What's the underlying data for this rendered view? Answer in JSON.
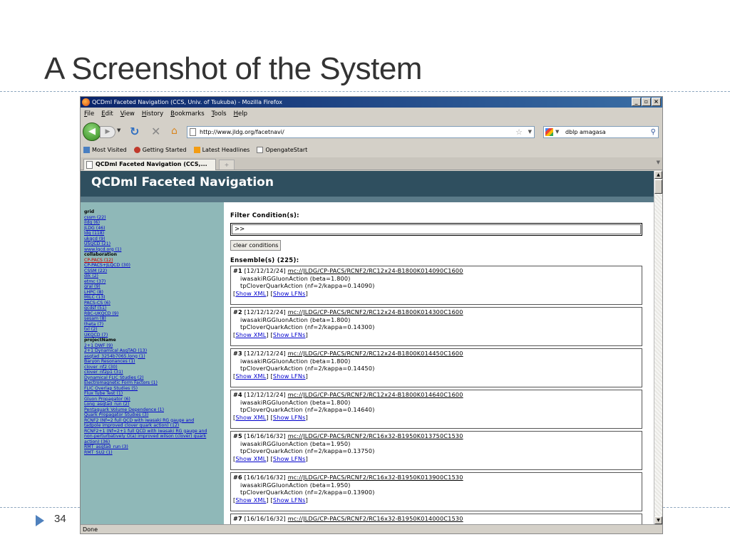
{
  "slide": {
    "title": "A Screenshot of the System",
    "page_number": "34"
  },
  "browser": {
    "window_title": "QCDml Faceted Navigation (CCS, Univ. of Tsukuba) - Mozilla Firefox",
    "menu": [
      "File",
      "Edit",
      "View",
      "History",
      "Bookmarks",
      "Tools",
      "Help"
    ],
    "url": "http://www.jldg.org/facetnavi/",
    "search_value": "dblp amagasa",
    "bookmarks": [
      "Most Visited",
      "Getting Started",
      "Latest Headlines",
      "OpengateStart"
    ],
    "tab_title": "QCDml Faceted Navigation (CCS,...",
    "status": "Done",
    "colors": {
      "header_bg": "#2f4f5f",
      "sidebar_bg": "#8fb8b8",
      "link": "#0000cc",
      "active_link": "#cc0000"
    },
    "icons": [
      "firefox-icon",
      "back-icon",
      "forward-icon",
      "reload-icon",
      "stop-icon",
      "home-icon",
      "page-icon",
      "star-icon",
      "google-icon",
      "magnifier-icon"
    ]
  },
  "page": {
    "header": "QCDml Faceted Navigation",
    "facets": [
      {
        "title": "grid",
        "items": [
          {
            "label": "cssm (22)",
            "active": false
          },
          {
            "label": "ildg (6)",
            "active": false
          },
          {
            "label": "JLDG (46)",
            "active": false
          },
          {
            "label": "ldg (118)",
            "active": false
          },
          {
            "label": "ukqcd (9)",
            "active": false
          },
          {
            "label": "USQCD (21)",
            "active": false
          },
          {
            "label": "www.lqcd.org (1)",
            "active": false
          }
        ]
      },
      {
        "title": "collaboration",
        "items": [
          {
            "label": "CP-PACS (12)",
            "active": true
          },
          {
            "label": "CP-PACS+JLQCD (30)",
            "active": false
          },
          {
            "label": "CSSM (22)",
            "active": false
          },
          {
            "label": "dik (2)",
            "active": false
          },
          {
            "label": "etmc (37)",
            "active": false
          },
          {
            "label": "gral (9)",
            "active": false
          },
          {
            "label": "LHPC (8)",
            "active": false
          },
          {
            "label": "MILC (13)",
            "active": false
          },
          {
            "label": "PACS-CS (6)",
            "active": false
          },
          {
            "label": "qcdsf (51)",
            "active": false
          },
          {
            "label": "RBC-UKQCD (9)",
            "active": false
          },
          {
            "label": "sesam (8)",
            "active": false
          },
          {
            "label": "theta (7)",
            "active": false
          },
          {
            "label": "txl (2)",
            "active": false
          },
          {
            "label": "UKQCD (7)",
            "active": false
          }
        ]
      },
      {
        "title": "projectName",
        "items": [
          {
            "label": "2+1 DWF (9)",
            "active": false
          },
          {
            "label": "2+1 Dynamical AsqTAD (13)",
            "active": false
          },
          {
            "label": "asqtad_3254b7065.long (1)",
            "active": false
          },
          {
            "label": "Baryon Resonances (1)",
            "active": false
          },
          {
            "label": "clover_nf2 (30)",
            "active": false
          },
          {
            "label": "clover_nf2p1 (31)",
            "active": false
          },
          {
            "label": "Dynamical FLIC Studies (2)",
            "active": false
          },
          {
            "label": "Electromagnetic Form Factors (1)",
            "active": false
          },
          {
            "label": "FLIC Overlap Studies (5)",
            "active": false
          },
          {
            "label": "Flux Tube Test (1)",
            "active": false
          },
          {
            "label": "Gluon Propagator (6)",
            "active": false
          },
          {
            "label": "Long_asqtad_run (2)",
            "active": false
          },
          {
            "label": "Pentaquark Volume Dependence (1)",
            "active": false
          },
          {
            "label": "Quark Propagator Studies (3)",
            "active": false
          },
          {
            "label": "RCNF2 (Nf=2 full QCD with iwasaki RG gauge and",
            "active": false
          },
          {
            "label": "tadpole improved clover quark action) (12)",
            "active": false
          },
          {
            "label": "RCNF2+1 (Nf=2+1 full QCD with iwasaki RG gauge and",
            "active": false
          },
          {
            "label": "non-perturbatively O(a) improved wilson (clover) quark",
            "active": false
          },
          {
            "label": "action) (36)",
            "active": false
          },
          {
            "label": "RMT_asqtad_run (3)",
            "active": false
          },
          {
            "label": "RMT_SU2 (1)",
            "active": false
          }
        ]
      }
    ],
    "filter_label": "Filter Condition(s):",
    "filter_value": ">>",
    "clear_button": "clear conditions",
    "ensembles_label": "Ensemble(s) (225):",
    "ensembles": [
      {
        "num": "#1",
        "size": "[12/12/12/24]",
        "uri": "mc://JLDG/CP-PACS/RCNF2/RC12x24-B1800K014090C1600",
        "gauge": "iwasakiRGGluonAction (beta=1.800)",
        "quark": "tpCloverQuarkAction (nf=2/kappa=0.14090)"
      },
      {
        "num": "#2",
        "size": "[12/12/12/24]",
        "uri": "mc://JLDG/CP-PACS/RCNF2/RC12x24-B1800K014300C1600",
        "gauge": "iwasakiRGGluonAction (beta=1.800)",
        "quark": "tpCloverQuarkAction (nf=2/kappa=0.14300)"
      },
      {
        "num": "#3",
        "size": "[12/12/12/24]",
        "uri": "mc://JLDG/CP-PACS/RCNF2/RC12x24-B1800K014450C1600",
        "gauge": "iwasakiRGGluonAction (beta=1.800)",
        "quark": "tpCloverQuarkAction (nf=2/kappa=0.14450)"
      },
      {
        "num": "#4",
        "size": "[12/12/12/24]",
        "uri": "mc://JLDG/CP-PACS/RCNF2/RC12x24-B1800K014640C1600",
        "gauge": "iwasakiRGGluonAction (beta=1.800)",
        "quark": "tpCloverQuarkAction (nf=2/kappa=0.14640)"
      },
      {
        "num": "#5",
        "size": "[16/16/16/32]",
        "uri": "mc://JLDG/CP-PACS/RCNF2/RC16x32-B1950K013750C1530",
        "gauge": "iwasakiRGGluonAction (beta=1.950)",
        "quark": "tpCloverQuarkAction (nf=2/kappa=0.13750)"
      },
      {
        "num": "#6",
        "size": "[16/16/16/32]",
        "uri": "mc://JLDG/CP-PACS/RCNF2/RC16x32-B1950K013900C1530",
        "gauge": "iwasakiRGGluonAction (beta=1.950)",
        "quark": "tpCloverQuarkAction (nf=2/kappa=0.13900)"
      },
      {
        "num": "#7",
        "size": "[16/16/16/32]",
        "uri": "mc://JLDG/CP-PACS/RCNF2/RC16x32-B1950K014000C1530",
        "gauge": "",
        "quark": ""
      }
    ],
    "show_xml": "Show XML",
    "show_lfns": "Show LFNs"
  }
}
